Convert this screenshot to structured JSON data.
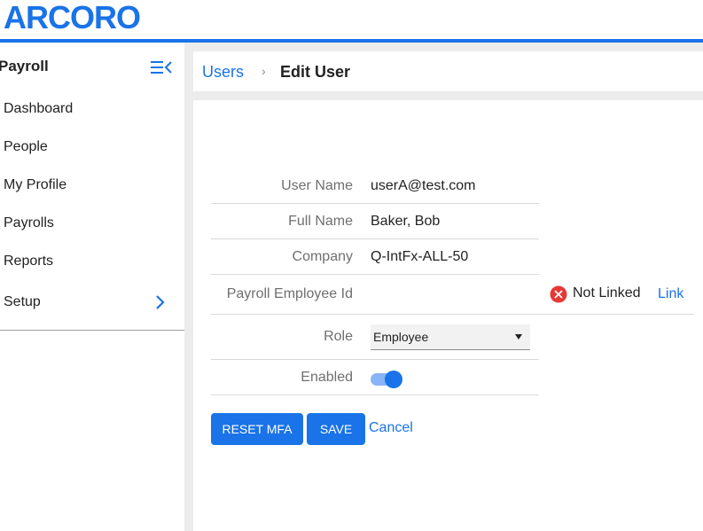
{
  "brand": {
    "logo_text": "ARCORO",
    "accent": "#1a73e8"
  },
  "sidebar": {
    "title": "Payroll",
    "items": [
      {
        "label": "Dashboard"
      },
      {
        "label": "People"
      },
      {
        "label": "My Profile"
      },
      {
        "label": "Payrolls"
      },
      {
        "label": "Reports"
      },
      {
        "label": "Setup",
        "has_children": true
      }
    ]
  },
  "breadcrumb": {
    "parent": "Users",
    "separator": "›",
    "current": "Edit User"
  },
  "form": {
    "user_name": {
      "label": "User Name",
      "value": "userA@test.com"
    },
    "full_name": {
      "label": "Full Name",
      "value": "Baker, Bob"
    },
    "company": {
      "label": "Company",
      "value": "Q-IntFx-ALL-50"
    },
    "payroll_employee_id": {
      "label": "Payroll Employee Id",
      "status": "Not Linked",
      "link_label": "Link"
    },
    "role": {
      "label": "Role",
      "value": "Employee"
    },
    "enabled": {
      "label": "Enabled",
      "on": true
    }
  },
  "actions": {
    "reset_mfa": "RESET MFA",
    "save": "SAVE",
    "cancel": "Cancel"
  }
}
